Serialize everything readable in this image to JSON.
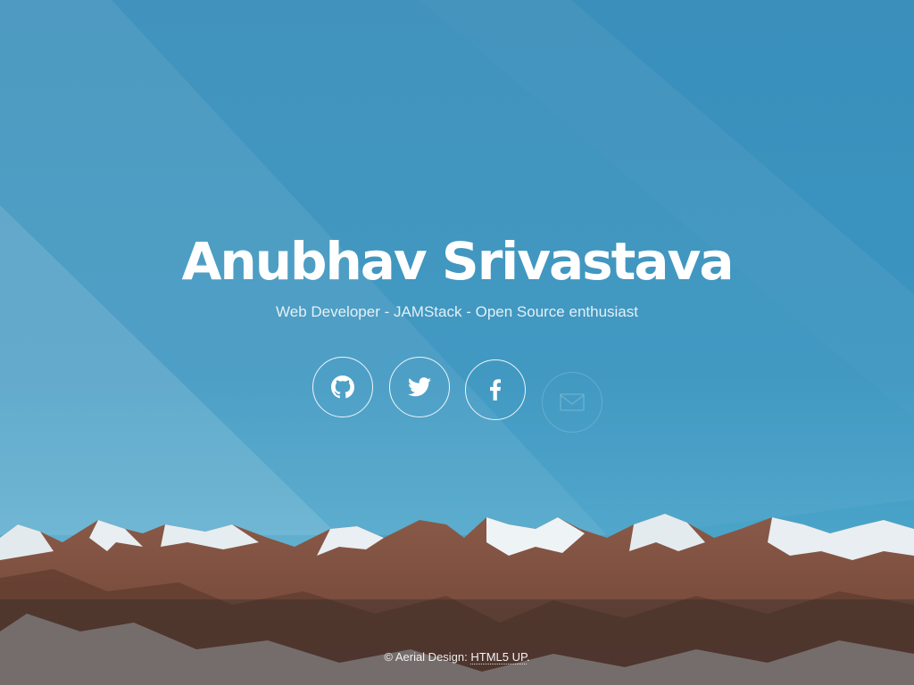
{
  "header": {
    "title": "Anubhav Srivastava",
    "subtitle": "Web Developer - JAMStack - Open Source enthusiast"
  },
  "social": [
    {
      "name": "github",
      "icon": "github-icon"
    },
    {
      "name": "twitter",
      "icon": "twitter-icon"
    },
    {
      "name": "facebook",
      "icon": "facebook-icon"
    },
    {
      "name": "email",
      "icon": "envelope-icon"
    }
  ],
  "footer": {
    "prefix": "© Aerial Design: ",
    "link_label": "HTML5 UP",
    "suffix": "."
  },
  "colors": {
    "sky": "#3a8fbb",
    "text": "#ffffff"
  }
}
